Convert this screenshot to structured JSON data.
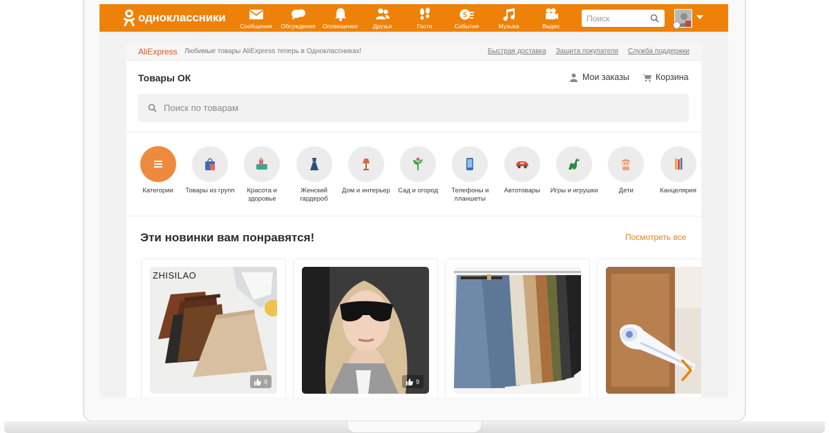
{
  "header": {
    "logo_text": "одноклассники",
    "nav": [
      {
        "label": "Сообщения",
        "icon": "envelope-icon"
      },
      {
        "label": "Обсуждения",
        "icon": "chat-bubbles-icon"
      },
      {
        "label": "Оповещение",
        "icon": "bell-icon"
      },
      {
        "label": "Друзья",
        "icon": "friends-icon"
      },
      {
        "label": "Гости",
        "icon": "footprints-icon"
      },
      {
        "label": "События",
        "icon": "events-icon",
        "badge": "5"
      },
      {
        "label": "Музыка",
        "icon": "music-note-icon"
      },
      {
        "label": "Видео",
        "icon": "video-camera-icon"
      }
    ],
    "search_placeholder": "Поиск"
  },
  "aliexpress_bar": {
    "brand": "AliExpress",
    "text": "Любимые товары AliExpress теперь в Одноклассниках!",
    "links": [
      "Быстрая доставка",
      "Защита покупателя",
      "Служба поддержки"
    ]
  },
  "shop": {
    "title": "Товары ОК",
    "orders_label": "Мои заказы",
    "cart_label": "Корзина",
    "search_placeholder": "Поиск по товарам"
  },
  "categories": [
    {
      "label": "Категории",
      "icon": "menu-icon"
    },
    {
      "label": "Товары из групп",
      "icon": "shopping-bag-icon"
    },
    {
      "label": "Красота и здоровье",
      "icon": "cosmetics-icon"
    },
    {
      "label": "Женский гардероб",
      "icon": "dress-icon"
    },
    {
      "label": "Дом и интерьер",
      "icon": "lamp-icon"
    },
    {
      "label": "Сад и огород",
      "icon": "plant-icon"
    },
    {
      "label": "Телефоны и планшеты",
      "icon": "phone-icon"
    },
    {
      "label": "Автотовары",
      "icon": "car-icon"
    },
    {
      "label": "Игры и игрушки",
      "icon": "dinosaur-icon"
    },
    {
      "label": "Дети",
      "icon": "baby-icon"
    },
    {
      "label": "Канцелярия",
      "icon": "pencils-icon"
    }
  ],
  "recommendations": {
    "title": "Эти новинки вам понравятся!",
    "see_all": "Посмотреть все",
    "products": [
      {
        "brand": "ZHISILAO",
        "likes": "9"
      },
      {
        "brand": "",
        "likes": "9"
      },
      {
        "brand": "",
        "likes": ""
      },
      {
        "brand": "",
        "likes": ""
      }
    ]
  },
  "colors": {
    "brand_orange": "#ee8208",
    "aliexpress_red": "#e8501e"
  }
}
